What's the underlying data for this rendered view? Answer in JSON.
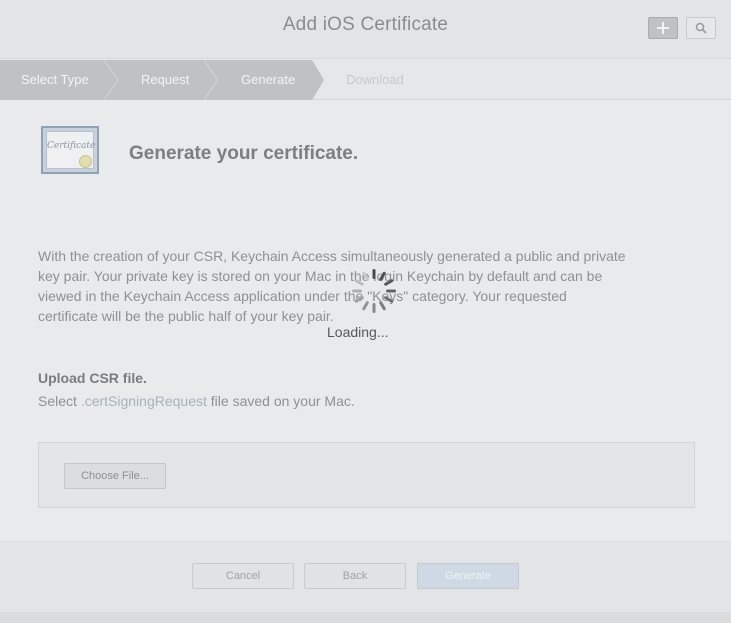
{
  "header": {
    "title": "Add iOS Certificate",
    "add_icon": "plus-icon",
    "search_icon": "search-icon"
  },
  "steps": [
    {
      "label": "Select Type",
      "state": "done"
    },
    {
      "label": "Request",
      "state": "done"
    },
    {
      "label": "Generate",
      "state": "current"
    },
    {
      "label": "Download",
      "state": "pending"
    }
  ],
  "main": {
    "cert_icon_text": "Certificate",
    "title": "Generate your certificate.",
    "paragraph_lines": [
      "With the creation of your CSR, Keychain Access simultaneously generated a public and private",
      "key pair. Your private key is stored on your Mac in the login Keychain by default and can be",
      "viewed in the Keychain Access application under the \"Keys\" category. Your requested",
      "certificate will be the public half of your key pair."
    ],
    "loading_text": "Loading...",
    "upload_title": "Upload CSR file.",
    "upload_desc_prefix": "Select ",
    "upload_desc_ext": ".certSigningRequest",
    "upload_desc_suffix": " file saved on your Mac.",
    "choose_file_label": "Choose File..."
  },
  "footer": {
    "cancel_label": "Cancel",
    "back_label": "Back",
    "generate_label": "Generate"
  },
  "colors": {
    "step_done": "#bfc1c3",
    "accent_disabled": "#cfd9e3"
  }
}
